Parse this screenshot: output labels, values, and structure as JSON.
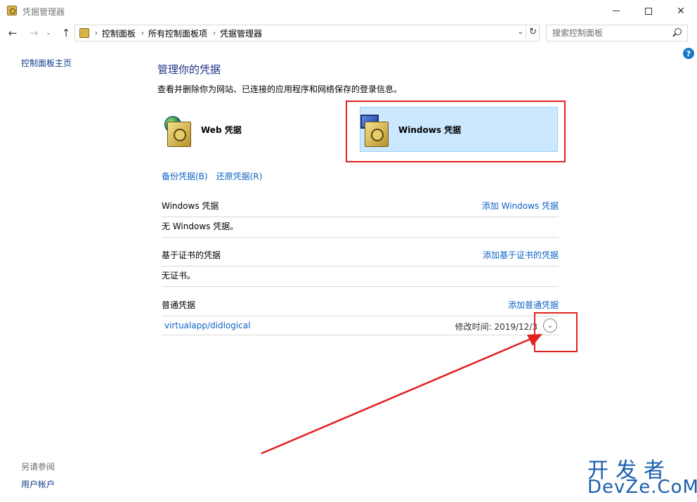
{
  "window": {
    "title": "凭据管理器",
    "controls": {
      "minimize": "—",
      "maximize": "☐",
      "close": "✕"
    }
  },
  "nav": {
    "back_icon": "←",
    "forward_icon": "→",
    "recent_icon": "⌄",
    "up_icon": "↑",
    "breadcrumbs": [
      "控制面板",
      "所有控制面板项",
      "凭据管理器"
    ],
    "breadcrumb_separator": "›",
    "dropdown_icon": "⌄",
    "refresh_icon": "↻",
    "search_placeholder": "搜索控制面板"
  },
  "help_label": "?",
  "sidebar": {
    "home": "控制面板主页",
    "see_also": "另请参阅",
    "user_accounts": "用户帐户"
  },
  "main": {
    "title": "管理你的凭据",
    "description": "查看并删除你为网站、已连接的应用程序和网络保存的登录信息。",
    "tiles": {
      "web": "Web 凭据",
      "windows": "Windows 凭据"
    },
    "actions": {
      "backup": "备份凭据(B)",
      "restore": "还原凭据(R)"
    },
    "sections": {
      "windows": {
        "title": "Windows 凭据",
        "add": "添加 Windows 凭据",
        "empty": "无 Windows 凭据。"
      },
      "certificate": {
        "title": "基于证书的凭据",
        "add": "添加基于证书的凭据",
        "empty": "无证书。"
      },
      "generic": {
        "title": "普通凭据",
        "add": "添加普通凭据",
        "items": [
          {
            "name": "virtualapp/didlogical",
            "modified": "修改时间: 2019/12/3"
          }
        ]
      }
    }
  },
  "expand_icon": "⌄",
  "watermark": {
    "line1": "开发者",
    "line2": "DevZe.CoM"
  },
  "colors": {
    "link": "#0c62c6",
    "title": "#1e3287",
    "selected_tile": "#cce8ff",
    "annotation": "#e32020"
  }
}
